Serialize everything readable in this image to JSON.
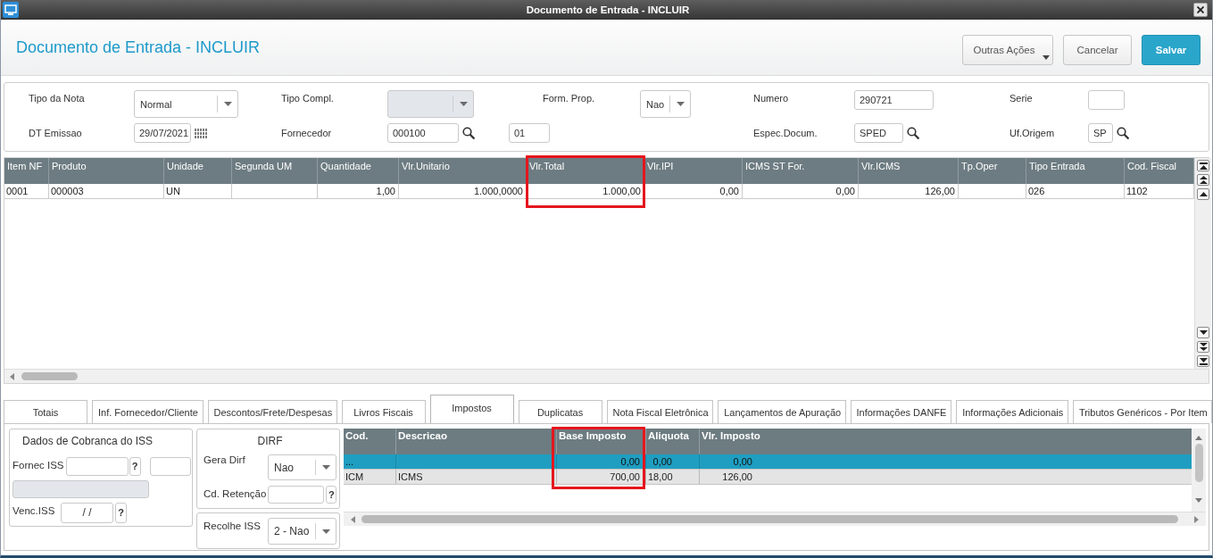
{
  "window": {
    "title": "Documento de Entrada - INCLUIR"
  },
  "header": {
    "title": "Documento de Entrada - INCLUIR",
    "buttons": [
      {
        "label": "Outras Ações",
        "kind": "menu"
      },
      {
        "label": "Cancelar",
        "kind": "secondary"
      },
      {
        "label": "Salvar",
        "kind": "primary"
      }
    ]
  },
  "form": {
    "rows": [
      [
        {
          "label": "Tipo da Nota",
          "kind": "select",
          "value": "Normal",
          "disabled": false
        },
        {
          "label": "Tipo Compl.",
          "kind": "select",
          "disabled": true
        },
        {
          "label": "Form. Prop.",
          "kind": "select",
          "value": "Nao",
          "disabled": false
        },
        {
          "label": "Numero",
          "kind": "input",
          "value": "290721",
          "disabled": false
        },
        {
          "label": "Serie",
          "kind": "input",
          "disabled": false
        }
      ],
      [
        {
          "label": "DT Emissao",
          "kind": "date",
          "value": "29/07/2021",
          "disabled": false
        },
        {
          "label": "Fornecedor",
          "kind": "lookup",
          "value": "000100",
          "disabled": false
        },
        {
          "kind": "input",
          "value": "01",
          "disabled": false
        },
        {
          "label": "Espec.Docum.",
          "kind": "lookup",
          "value": "SPED",
          "disabled": false
        },
        {
          "label": "Uf.Origem",
          "kind": "lookup",
          "value": "SP",
          "disabled": false
        }
      ]
    ]
  },
  "items_grid": {
    "columns": [
      {
        "label": "Item NF",
        "kind": "text",
        "highlighted": false
      },
      {
        "label": "Produto",
        "kind": "text",
        "highlighted": false
      },
      {
        "label": "Unidade",
        "kind": "text",
        "highlighted": false
      },
      {
        "label": "Segunda UM",
        "kind": "text",
        "highlighted": false
      },
      {
        "label": "Quantidade",
        "kind": "number",
        "highlighted": false
      },
      {
        "label": "Vlr.Unitario",
        "kind": "number",
        "highlighted": false
      },
      {
        "label": "Vlr.Total",
        "kind": "number",
        "highlighted": true
      },
      {
        "label": "Vlr.IPI",
        "kind": "number",
        "highlighted": false
      },
      {
        "label": "ICMS ST For.",
        "kind": "number",
        "highlighted": false
      },
      {
        "label": "Vlr.ICMS",
        "kind": "number",
        "highlighted": false
      },
      {
        "label": "Tp.Oper",
        "kind": "text",
        "highlighted": false
      },
      {
        "label": "Tipo Entrada",
        "kind": "text",
        "highlighted": false
      },
      {
        "label": "Cod. Fiscal",
        "kind": "text",
        "highlighted": false
      }
    ],
    "rows": [
      {
        "cells": [
          "0001",
          "000003",
          "UN",
          null,
          "1,00",
          "1.000,0000",
          "1.000,00",
          "0,00",
          "0,00",
          "126,00",
          null,
          "026",
          "1102"
        ]
      }
    ]
  },
  "tabs": [
    {
      "label": "Totais",
      "selected": false
    },
    {
      "label": "Inf. Fornecedor/Cliente",
      "selected": false
    },
    {
      "label": "Descontos/Frete/Despesas",
      "selected": false
    },
    {
      "label": "Livros Fiscais",
      "selected": false
    },
    {
      "label": "Impostos",
      "selected": true
    },
    {
      "label": "Duplicatas",
      "selected": false
    },
    {
      "label": "Nota Fiscal Eletrônica",
      "selected": false
    },
    {
      "label": "Lançamentos de Apuração",
      "selected": false
    },
    {
      "label": "Informações DANFE",
      "selected": false
    },
    {
      "label": "Informações Adicionais",
      "selected": false
    },
    {
      "label": "Tributos Genéricos - Por Item",
      "selected": false
    }
  ],
  "boxes": [
    {
      "title": "Dados de Cobranca do ISS",
      "rows": [
        {
          "label": "Fornec ISS",
          "fields": [
            {
              "kind": "input",
              "disabled": false
            },
            {
              "kind": "help",
              "label": "?",
              "disabled": false
            },
            {
              "kind": "input",
              "disabled": false
            }
          ]
        },
        {
          "fields": [
            {
              "kind": "input",
              "disabled": true
            }
          ]
        },
        {
          "label": "Venc.ISS",
          "fields": [
            {
              "kind": "input",
              "value": "/ /",
              "disabled": false
            },
            {
              "kind": "help",
              "label": "?",
              "disabled": false
            }
          ]
        }
      ]
    },
    {
      "title": "DIRF",
      "rows": [
        {
          "label": "Gera Dirf",
          "fields": [
            {
              "kind": "select",
              "value": "Nao",
              "disabled": false
            }
          ]
        },
        {
          "label": "Cd. Retenção",
          "fields": [
            {
              "kind": "input",
              "disabled": false
            },
            {
              "kind": "help",
              "label": "?",
              "disabled": false
            }
          ]
        }
      ]
    },
    {
      "rows": [
        {
          "label": "Recolhe ISS",
          "fields": [
            {
              "kind": "select",
              "value": "2 - Nao",
              "disabled": false
            }
          ]
        }
      ]
    }
  ],
  "tax_grid": {
    "columns": [
      {
        "label": "Cod.",
        "kind": "text",
        "highlighted": false
      },
      {
        "label": "Descricao",
        "kind": "text",
        "highlighted": false
      },
      {
        "label": "Base Imposto",
        "kind": "number",
        "highlighted": true
      },
      {
        "label": "Aliquota",
        "kind": "number",
        "highlighted": false
      },
      {
        "label": "Vlr. Imposto",
        "kind": "number",
        "highlighted": false
      }
    ],
    "rows": [
      {
        "selected": true,
        "cells": [
          "...",
          null,
          "0,00",
          "0,00",
          "0,00"
        ]
      },
      {
        "selected": false,
        "cells": [
          "ICM",
          "ICMS",
          "700,00",
          "18,00",
          "126,00"
        ]
      }
    ]
  }
}
